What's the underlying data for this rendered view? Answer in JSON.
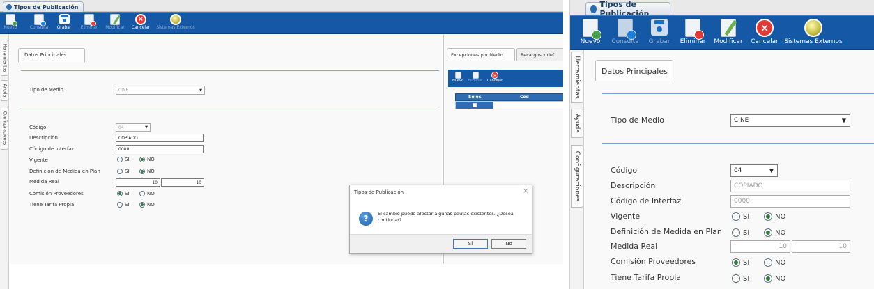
{
  "app": {
    "title": "Tipos de Publicación"
  },
  "toolbar": {
    "nuevo": "Nuevo",
    "consulta": "Consulta",
    "grabar": "Grabar",
    "eliminar": "Eliminar",
    "modificar": "Modificar",
    "cancelar": "Cancelar",
    "sistemas_externos": "Sistemas Externos",
    "left_enabled": [
      "grabar",
      "cancelar"
    ],
    "right_enabled": [
      "nuevo",
      "eliminar",
      "modificar",
      "cancelar",
      "sistemas_externos"
    ]
  },
  "sidebar": {
    "tabs": [
      "Herramientas",
      "Ayuda",
      "Configuraciones"
    ]
  },
  "form": {
    "section_tab": "Datos Principales",
    "tipo_medio": {
      "label": "Tipo de Medio",
      "value": "CINE"
    },
    "codigo": {
      "label": "Código",
      "value": "04"
    },
    "descripcion": {
      "label": "Descripción",
      "value": "COPIADO"
    },
    "codigo_interfaz": {
      "label": "Código de Interfaz",
      "value": "0000"
    },
    "vigente": {
      "label": "Vigente",
      "selected": "NO"
    },
    "definicion_medida": {
      "label": "Definición de Medida en Plan",
      "selected": "NO"
    },
    "medida_real": {
      "label": "Medida Real",
      "value1": "10",
      "value2": "10"
    },
    "comision": {
      "label": "Comisión Proveedores",
      "selected": "SI"
    },
    "tarifa": {
      "label": "Tiene Tarifa Propia",
      "selected": "NO"
    },
    "opt_si": "SI",
    "opt_no": "NO"
  },
  "exceptions": {
    "tab1": "Excepciones por Medio",
    "tab2": "Recargos x def",
    "nuevo": "Nuevo",
    "eliminar": "Eliminar",
    "cancelar": "Cancelar",
    "col_selec": "Selec.",
    "col_cod": "Cód"
  },
  "dialog": {
    "title": "Tipos de Publicación",
    "close": "×",
    "message": "El cambio puede afectar algunas pautas existentes. ¿Desea continuar?",
    "yes": "Sí",
    "no": "No"
  },
  "colors": {
    "toolbar": "#1558a6",
    "grid_header": "#2e6db4",
    "accent_line": "#7ea3c9",
    "radio_on": "#2e7d32"
  }
}
